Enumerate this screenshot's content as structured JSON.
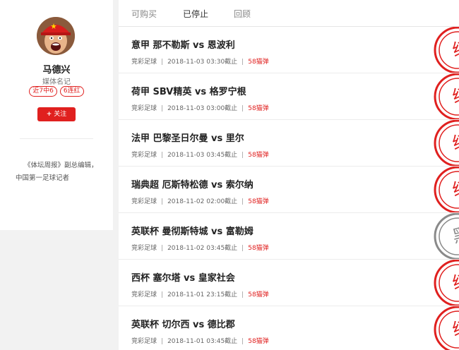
{
  "profile": {
    "name": "马德兴",
    "title": "媒体名记",
    "badges": [
      "近7中6",
      "6连红"
    ],
    "follow_plus": "+",
    "follow_label": "关注",
    "bio": "《体坛周报》副总编辑，中国第一足球记者"
  },
  "tabs": [
    {
      "label": "可购买",
      "active": false
    },
    {
      "label": "已停止",
      "active": true
    },
    {
      "label": "回顾",
      "active": false
    }
  ],
  "matches": [
    {
      "title": "意甲 那不勒斯 vs 恩波利",
      "category": "竞彩足球",
      "time": "2018-11-03 03:30截止",
      "price": "58猫弹",
      "result": "红",
      "result_color": "#e0201f"
    },
    {
      "title": "荷甲 SBV精英 vs 格罗宁根",
      "category": "竞彩足球",
      "time": "2018-11-03 03:00截止",
      "price": "58猫弹",
      "result": "红",
      "result_color": "#e0201f"
    },
    {
      "title": "法甲 巴黎圣日尔曼 vs 里尔",
      "category": "竞彩足球",
      "time": "2018-11-03 03:45截止",
      "price": "58猫弹",
      "result": "红",
      "result_color": "#e0201f"
    },
    {
      "title": "瑞典超 厄斯特松德 vs 索尔纳",
      "category": "竞彩足球",
      "time": "2018-11-02 02:00截止",
      "price": "58猫弹",
      "result": "红",
      "result_color": "#e0201f"
    },
    {
      "title": "英联杯 曼彻斯特城 vs 富勒姆",
      "category": "竞彩足球",
      "time": "2018-11-02 03:45截止",
      "price": "58猫弹",
      "result": "黑",
      "result_color": "#8a8a8a"
    },
    {
      "title": "西杯 塞尔塔 vs 皇家社会",
      "category": "竞彩足球",
      "time": "2018-11-01 23:15截止",
      "price": "58猫弹",
      "result": "红",
      "result_color": "#e0201f"
    },
    {
      "title": "英联杯 切尔西 vs 德比郡",
      "category": "竞彩足球",
      "time": "2018-11-01 03:45截止",
      "price": "58猫弹",
      "result": "红",
      "result_color": "#e0201f"
    }
  ]
}
